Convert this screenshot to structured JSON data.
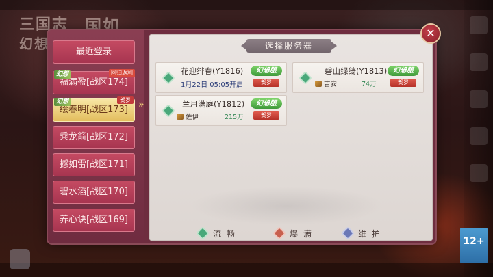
{
  "background": {
    "logo_line1": "三国志",
    "logo_line2": "幻想大",
    "logo_line3": "国如",
    "age_rating": "12+"
  },
  "dialog": {
    "title": "选择服务器",
    "close_symbol": "✕",
    "selected_arrow": "»"
  },
  "sidebar": {
    "recent_label": "最近登录",
    "items": [
      {
        "label": "福满盈[战区174]",
        "tag_left": "幻想",
        "tag_right": "回归返利"
      },
      {
        "label": "绘春明[战区173]",
        "tag_left": "幻想",
        "tag_right": "贺岁",
        "selected": true
      },
      {
        "label": "乘龙箭[战区172]"
      },
      {
        "label": "撼如雷[战区171]"
      },
      {
        "label": "碧水滔[战区170]"
      },
      {
        "label": "养心诀[战区169]"
      }
    ]
  },
  "servers": [
    {
      "name": "花迎绯春(Y1816)",
      "sub": "1月22日 05:05开启",
      "status": "green",
      "badge": "幻想服",
      "badge2": "贺岁"
    },
    {
      "name": "碧山绿绮(Y1813)",
      "player": "吉安",
      "power": "74万",
      "status": "green",
      "badge": "幻想服",
      "badge2": "贺岁"
    },
    {
      "name": "兰月满庭(Y1812)",
      "player": "佐伊",
      "power": "215万",
      "status": "green",
      "badge": "幻想服",
      "badge2": "贺岁"
    }
  ],
  "legend": [
    {
      "label": "流 畅",
      "color": "green"
    },
    {
      "label": "爆 满",
      "color": "red"
    },
    {
      "label": "维 护",
      "color": "blue"
    }
  ],
  "colors": {
    "dialog_frame": "#6e2d3f",
    "tab_normal": "#b73d57",
    "tab_selected": "#efd282",
    "status_green": "#49a87a",
    "status_red": "#c85f4e",
    "status_blue": "#6b78b7"
  }
}
